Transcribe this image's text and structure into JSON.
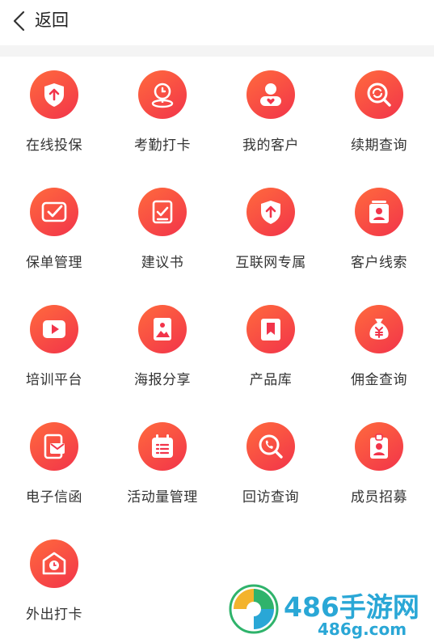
{
  "header": {
    "back_label": "返回"
  },
  "menu": [
    {
      "label": "在线投保",
      "icon": "shield-upload-icon"
    },
    {
      "label": "考勤打卡",
      "icon": "location-clock-icon"
    },
    {
      "label": "我的客户",
      "icon": "customer-heart-icon"
    },
    {
      "label": "续期查询",
      "icon": "renew-search-icon"
    },
    {
      "label": "保单管理",
      "icon": "policy-check-icon"
    },
    {
      "label": "建议书",
      "icon": "proposal-scroll-icon"
    },
    {
      "label": "互联网专属",
      "icon": "shield-upload-icon"
    },
    {
      "label": "客户线索",
      "icon": "contact-card-icon"
    },
    {
      "label": "培训平台",
      "icon": "video-play-icon"
    },
    {
      "label": "海报分享",
      "icon": "poster-image-icon"
    },
    {
      "label": "产品库",
      "icon": "bookmark-box-icon"
    },
    {
      "label": "佣金查询",
      "icon": "money-bag-icon"
    },
    {
      "label": "电子信函",
      "icon": "e-letter-icon"
    },
    {
      "label": "活动量管理",
      "icon": "calendar-list-icon"
    },
    {
      "label": "回访查询",
      "icon": "phone-search-icon"
    },
    {
      "label": "成员招募",
      "icon": "id-badge-icon"
    },
    {
      "label": "外出打卡",
      "icon": "house-clock-icon"
    }
  ],
  "watermark": {
    "title": "486手游网",
    "subtitle": "486g.com"
  },
  "colors": {
    "accent_start": "#ff6a3d",
    "accent_end": "#f2344a",
    "watermark": "#2aa7d6"
  }
}
